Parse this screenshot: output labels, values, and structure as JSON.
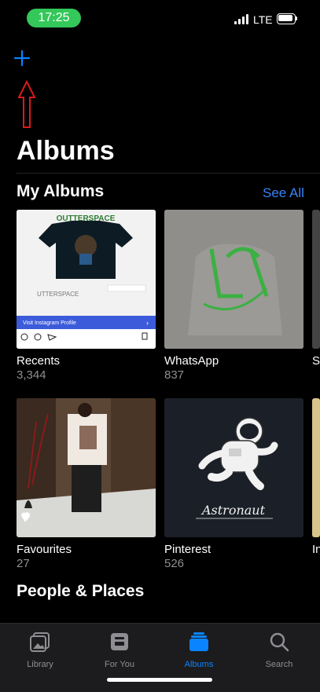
{
  "status_bar": {
    "time": "17:25",
    "network": "LTE"
  },
  "header": {
    "title": "Albums"
  },
  "my_albums": {
    "title": "My Albums",
    "see_all": "See All",
    "albums": [
      {
        "name": "Recents",
        "count": "3,344",
        "cover_caption": "Visit Instagram Profile"
      },
      {
        "name": "WhatsApp",
        "count": "837"
      },
      {
        "name": "S",
        "count": ""
      },
      {
        "name": "Favourites",
        "count": "27"
      },
      {
        "name": "Pinterest",
        "count": "526",
        "cover_caption": "Astronaut"
      },
      {
        "name": "In",
        "count": ""
      }
    ]
  },
  "people_places": {
    "title": "People & Places"
  },
  "tabbar": {
    "tabs": [
      {
        "label": "Library",
        "icon": "library-icon",
        "active": false
      },
      {
        "label": "For You",
        "icon": "for-you-icon",
        "active": false
      },
      {
        "label": "Albums",
        "icon": "albums-icon",
        "active": true
      },
      {
        "label": "Search",
        "icon": "search-icon",
        "active": false
      }
    ]
  },
  "colors": {
    "accent": "#0a84ff",
    "see_all": "#3b82f6",
    "status_pill": "#34c759",
    "annotation_arrow": "#d81b1b"
  }
}
